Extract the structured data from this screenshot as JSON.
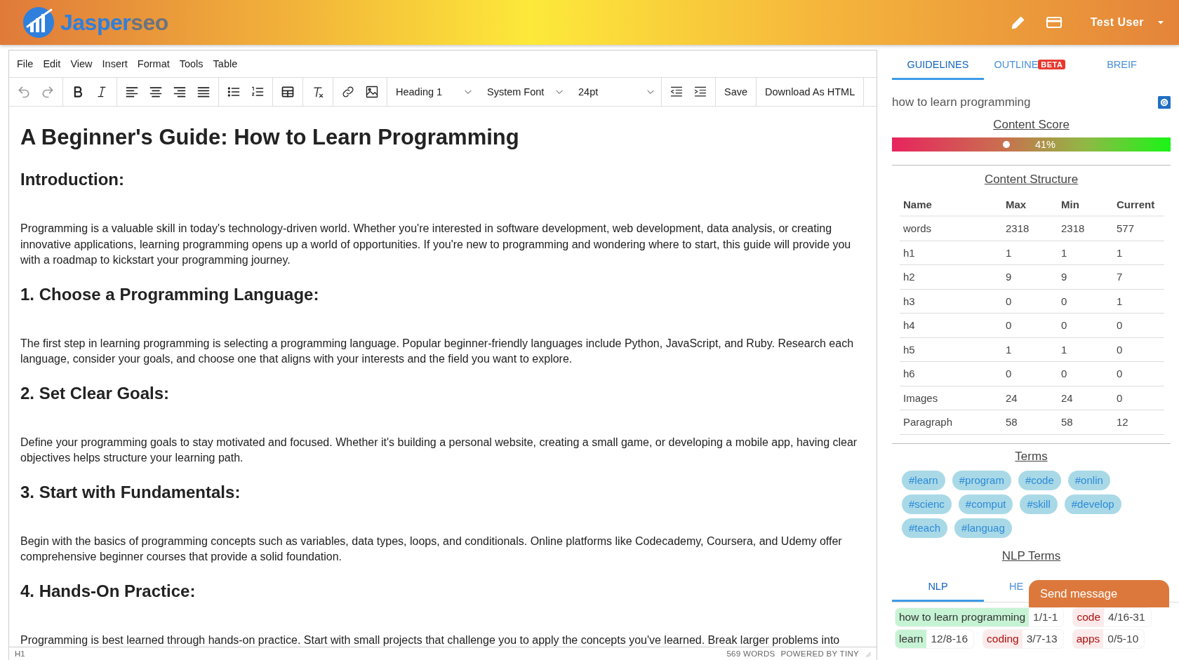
{
  "header": {
    "brand": [
      "Jasper",
      "seo"
    ],
    "user": "Test User"
  },
  "editor": {
    "menu": [
      "File",
      "Edit",
      "View",
      "Insert",
      "Format",
      "Tools",
      "Table"
    ],
    "toolbar": {
      "history": [
        {
          "disabled": true
        },
        {
          "disabled": true
        }
      ],
      "dropdowns": [
        "Heading 1",
        "System Font",
        "24pt"
      ],
      "buttons": [
        "Save",
        "Download As HTML"
      ]
    },
    "content": [
      {
        "kind": "title",
        "text": "A Beginner's Guide: How to Learn Programming"
      },
      {
        "kind": "heading",
        "text": "Introduction:"
      },
      {
        "kind": "paragraph",
        "text": "Programming is a valuable skill in today's technology-driven world. Whether you're interested in software development, web development, data analysis, or creating innovative applications, learning programming opens up a world of opportunities. If you're new to programming and wondering where to start, this guide will provide you with a roadmap to kickstart your programming journey."
      },
      {
        "kind": "heading",
        "text": "1. Choose a Programming Language:"
      },
      {
        "kind": "paragraph",
        "text": "The first step in learning programming is selecting a programming language. Popular beginner-friendly languages include Python, JavaScript, and Ruby. Research each language, consider your goals, and choose one that aligns with your interests and the field you want to explore."
      },
      {
        "kind": "heading",
        "text": "2. Set Clear Goals:"
      },
      {
        "kind": "paragraph",
        "text": "Define your programming goals to stay motivated and focused. Whether it's building a personal website, creating a small game, or developing a mobile app, having clear objectives helps structure your learning path."
      },
      {
        "kind": "heading",
        "text": "3. Start with Fundamentals:"
      },
      {
        "kind": "paragraph",
        "text": "Begin with the basics of programming concepts such as variables, data types, loops, and conditionals. Online platforms like Codecademy, Coursera, and Udemy offer comprehensive beginner courses that provide a solid foundation."
      },
      {
        "kind": "heading",
        "text": "4. Hands-On Practice:"
      },
      {
        "kind": "paragraph",
        "text": "Programming is best learned through hands-on practice. Start with small projects that challenge you to apply the concepts you've learned. Break larger problems into"
      }
    ],
    "status": {
      "path": "H1",
      "words": "569 WORDS",
      "powered": "POWERED BY TINY"
    }
  },
  "panel": {
    "tabs": [
      {
        "label": "GUIDELINES",
        "selected": true
      },
      {
        "label": "OUTLINE",
        "badge": "BETA",
        "selected": false
      },
      {
        "label": "BREIF",
        "selected": false
      }
    ],
    "keyword": "how to learn programming",
    "score": {
      "title": "Content Score",
      "level": 0.41,
      "reading": "41%"
    },
    "structure": {
      "title": "Content Structure",
      "columns": [
        "Name",
        "Max",
        "Min",
        "Current"
      ],
      "rows": [
        [
          "words",
          "2318",
          "2318",
          "577"
        ],
        [
          "h1",
          "1",
          "1",
          "1"
        ],
        [
          "h2",
          "9",
          "9",
          "7"
        ],
        [
          "h3",
          "0",
          "0",
          "1"
        ],
        [
          "h4",
          "0",
          "0",
          "0"
        ],
        [
          "h5",
          "1",
          "1",
          "0"
        ],
        [
          "h6",
          "0",
          "0",
          "0"
        ],
        [
          "Images",
          "24",
          "24",
          "0"
        ],
        [
          "Paragraph",
          "58",
          "58",
          "12"
        ]
      ]
    },
    "terms": {
      "title": "Terms",
      "tags": [
        "#learn",
        "#program",
        "#code",
        "#onlin",
        "#scienc",
        "#comput",
        "#skill",
        "#develop",
        "#teach",
        "#languag"
      ]
    },
    "nlp": {
      "title": "NLP Terms",
      "tabs": [
        {
          "label": "NLP",
          "selected": true
        },
        {
          "label": "HE",
          "selected": false
        }
      ],
      "items": [
        {
          "term": "how to learn programming",
          "count": "1/1-1",
          "found": true
        },
        {
          "term": "code",
          "count": "4/16-31",
          "found": false
        },
        {
          "term": "learn",
          "count": "12/8-16",
          "found": true
        },
        {
          "term": "coding",
          "count": "3/7-13",
          "found": false
        },
        {
          "term": "apps",
          "count": "0/5-10",
          "found": false
        }
      ]
    }
  },
  "chat": {
    "label": "Send message"
  }
}
